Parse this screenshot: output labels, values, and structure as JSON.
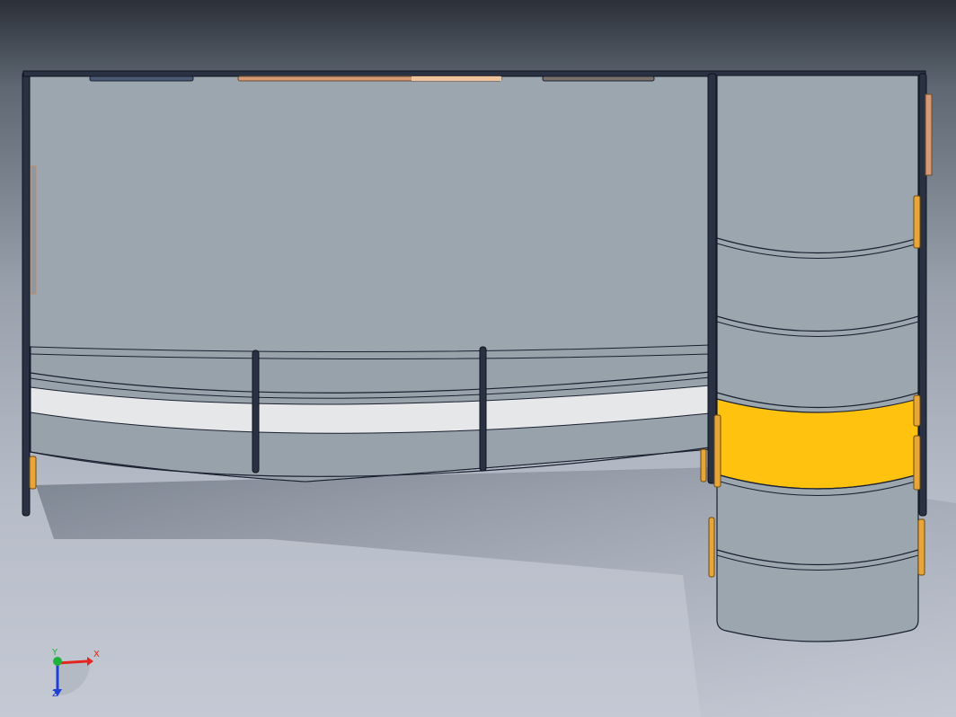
{
  "view": {
    "triad": {
      "x_label": "X",
      "y_label": "Y",
      "z_label": "Z",
      "x_color": "#e5251f",
      "y_color": "#1fb23a",
      "z_color": "#1f3fd6"
    },
    "colors": {
      "panel": "#9ba6af",
      "panel_shade": "#8d98a2",
      "edge": "#1a2030",
      "strip": "#e6e7e9",
      "highlight": "#ffc20f",
      "bracket": "#e8a53a",
      "copper": "#d79a74"
    }
  }
}
